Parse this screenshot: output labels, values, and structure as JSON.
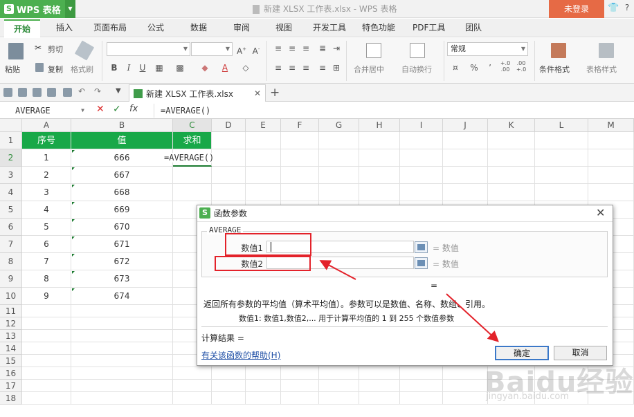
{
  "titlebar": {
    "app_label": "WPS 表格",
    "window_title": "新建 XLSX 工作表.xlsx - WPS 表格",
    "login_label": "未登录"
  },
  "menu": {
    "items": [
      "开始",
      "插入",
      "页面布局",
      "公式",
      "数据",
      "审阅",
      "视图",
      "开发工具",
      "特色功能",
      "PDF工具",
      "团队"
    ]
  },
  "ribbon": {
    "paste": "粘贴",
    "cut": "剪切",
    "copy": "复制",
    "format_painter": "格式刷",
    "bold": "B",
    "italic": "I",
    "underline": "U",
    "merge_center": "合并居中",
    "wrap_text": "自动换行",
    "number_format": "常规",
    "percent": "%",
    "comma": "’",
    "inc_decimal": "+.0\n.00",
    "dec_decimal": ".00\n+.0",
    "conditional_format": "条件格式",
    "table_style": "表格样式"
  },
  "doc_tab": {
    "name": "新建 XLSX 工作表.xlsx"
  },
  "formula_bar": {
    "name_box": "AVERAGE",
    "cancel": "✕",
    "confirm": "✓",
    "fx": "fx",
    "formula": "=AVERAGE()"
  },
  "sheet": {
    "columns": [
      "A",
      "B",
      "C",
      "D",
      "E",
      "F",
      "G",
      "H",
      "I",
      "J",
      "K",
      "L",
      "M"
    ],
    "rows": [
      "1",
      "2",
      "3",
      "4",
      "5",
      "6",
      "7",
      "8",
      "9",
      "10",
      "11",
      "12",
      "13",
      "14",
      "15",
      "16",
      "17",
      "18"
    ],
    "headers": [
      "序号",
      "值",
      "求和"
    ],
    "data": [
      [
        "1",
        "666"
      ],
      [
        "2",
        "667"
      ],
      [
        "3",
        "668"
      ],
      [
        "4",
        "669"
      ],
      [
        "5",
        "670"
      ],
      [
        "6",
        "671"
      ],
      [
        "7",
        "672"
      ],
      [
        "8",
        "673"
      ],
      [
        "9",
        "674"
      ]
    ],
    "editing_cell": "=AVERAGE()"
  },
  "dialog": {
    "title": "函数参数",
    "function_name": "AVERAGE",
    "arg1_label": "数值1",
    "arg2_label": "数值2",
    "arg1_eq": "=  数值",
    "arg2_eq": "=  数值",
    "result_eq": "=",
    "description": "返回所有参数的平均值（算术平均值）。参数可以是数值、名称、数组、引用。",
    "arg_help": "数值1:   数值1,数值2,... 用于计算平均值的 1 到 255 个数值参数",
    "result_label": "计算结果  =",
    "help_link": "有关该函数的帮助(H)",
    "ok": "确定",
    "cancel": "取消"
  },
  "watermark": {
    "logo": "Baidu经验",
    "url": "jingyan.baidu.com"
  },
  "colors": {
    "accent": "#4caf50",
    "header_fill": "#18a848",
    "login": "#e66a45",
    "annotation": "#e3222a"
  }
}
